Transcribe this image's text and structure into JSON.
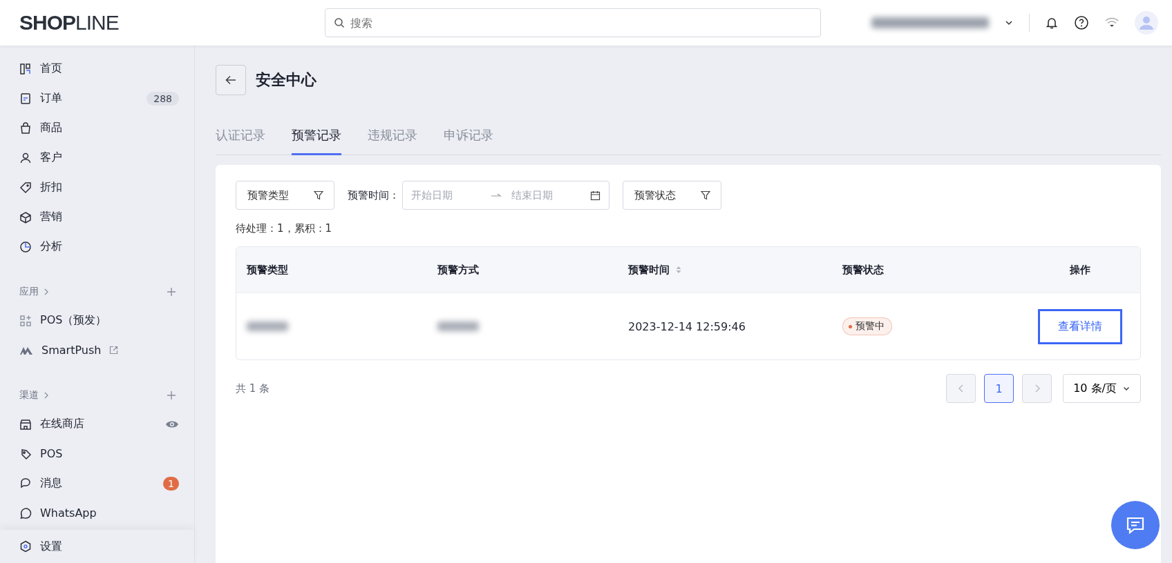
{
  "header": {
    "logo": "**SHOP**LINE",
    "search": {
      "placeholder": "搜索"
    }
  },
  "sidebar": {
    "main": [
      {
        "label": "首页"
      },
      {
        "label": "订单",
        "badge": {
          "text": "288",
          "kind": "count"
        }
      },
      {
        "label": "商品"
      },
      {
        "label": "客户"
      },
      {
        "label": "折扣"
      },
      {
        "label": "营销"
      },
      {
        "label": "分析"
      }
    ],
    "sections": [
      {
        "title": "应用",
        "items": [
          {
            "label": "POS（预发）"
          },
          {
            "label": "SmartPush",
            "external": true
          }
        ]
      },
      {
        "title": "渠道",
        "items": [
          {
            "label": "在线商店",
            "preview": true
          },
          {
            "label": "POS"
          },
          {
            "label": "消息",
            "badge": {
              "text": "1",
              "kind": "alert"
            }
          },
          {
            "label": "WhatsApp"
          }
        ]
      }
    ],
    "footer": {
      "label": "设置"
    }
  },
  "page": {
    "title": "安全中心",
    "tabs": [
      {
        "label": "认证记录",
        "selected": false
      },
      {
        "label": "预警记录",
        "selected": true
      },
      {
        "label": "违规记录",
        "selected": false
      },
      {
        "label": "申诉记录",
        "selected": false
      }
    ],
    "filters": {
      "type": "预警类型",
      "time_label": "预警时间：",
      "start_placeholder": "开始日期",
      "end_placeholder": "结束日期",
      "status": "预警状态"
    },
    "summary": "待处理：1，累积：1",
    "table": {
      "columns": [
        {
          "label": "预警类型",
          "sortable": false
        },
        {
          "label": "预警方式",
          "sortable": false
        },
        {
          "label": "预警时间",
          "sortable": true
        },
        {
          "label": "预警状态",
          "sortable": false
        },
        {
          "label": "操作",
          "sortable": false
        }
      ],
      "rows": [
        {
          "time": "2023-12-14 12:59:46",
          "status": {
            "text": "预警中",
            "color": "#e06c45"
          },
          "action": "查看详情"
        }
      ]
    },
    "total": "共 1 条",
    "pagination": {
      "prev_disabled": true,
      "pages": [
        {
          "label": "1",
          "selected": true
        }
      ],
      "next_disabled": true,
      "page_size": "10 条/页"
    }
  }
}
